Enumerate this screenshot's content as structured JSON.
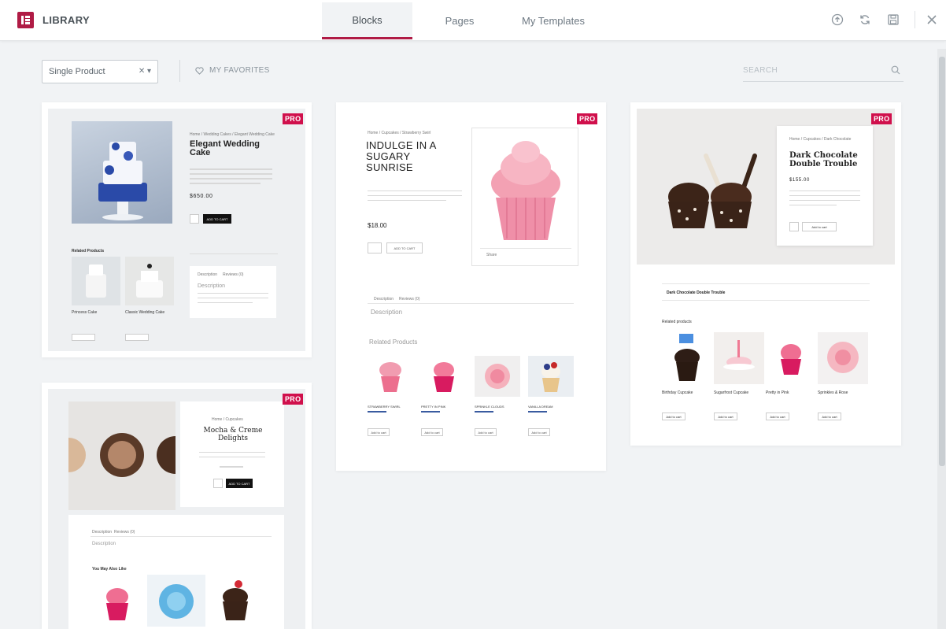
{
  "header": {
    "logo_title": "LIBRARY",
    "tabs": [
      {
        "label": "Blocks",
        "active": true
      },
      {
        "label": "Pages",
        "active": false
      },
      {
        "label": "My Templates",
        "active": false
      }
    ],
    "accent": "#b01b45"
  },
  "toolbar": {
    "category_value": "Single Product",
    "favorites_label": "MY FAVORITES",
    "search_placeholder": "SEARCH"
  },
  "badge": {
    "label": "PRO",
    "color": "#d0104c"
  },
  "cards": [
    {
      "id": "wedding",
      "title": "Elegant Wedding Cake",
      "price": "$650.00",
      "related_heading": "Related Products",
      "related_items": [
        "Princess Cake",
        "Classic Wedding Cake"
      ],
      "add_to_cart": "ADD TO CART",
      "tabs": [
        "Description",
        "Reviews (0)"
      ],
      "description": "Description"
    },
    {
      "id": "sunrise",
      "title": "INDULGE IN A SUGARY SUNRISE",
      "price": "$18.00",
      "add_to_cart": "ADD TO CART",
      "share": "Share",
      "tabs": [
        "Description",
        "Reviews (0)"
      ],
      "description": "Description",
      "related_heading": "Related Products",
      "related_items": [
        "STRAWBERRY SWIRL",
        "PRETTY IN PINK",
        "SPRINKLE CLOUDS",
        "VANILLA DREAM"
      ],
      "add_to_cart_small": "Add to cart"
    },
    {
      "id": "chocolate",
      "title": "Dark Chocolate Double Trouble",
      "price": "$155.00",
      "add_to_cart": "Add to cart",
      "bar_title": "Dark Chocolate Double Trouble",
      "related_heading": "Related products",
      "related_items": [
        "Birthday Cupcake",
        "Sugarfrost Cupcake",
        "Pretty in Pink",
        "Sprinkles & Rose"
      ],
      "add_to_cart_small": "Add to cart"
    },
    {
      "id": "mocha",
      "title": "Mocha & Creme Delights",
      "add_to_cart": "ADD TO CART",
      "tabs": [
        "Description",
        "Reviews (0)"
      ],
      "description": "Description",
      "related_heading": "You May Also Like"
    }
  ]
}
